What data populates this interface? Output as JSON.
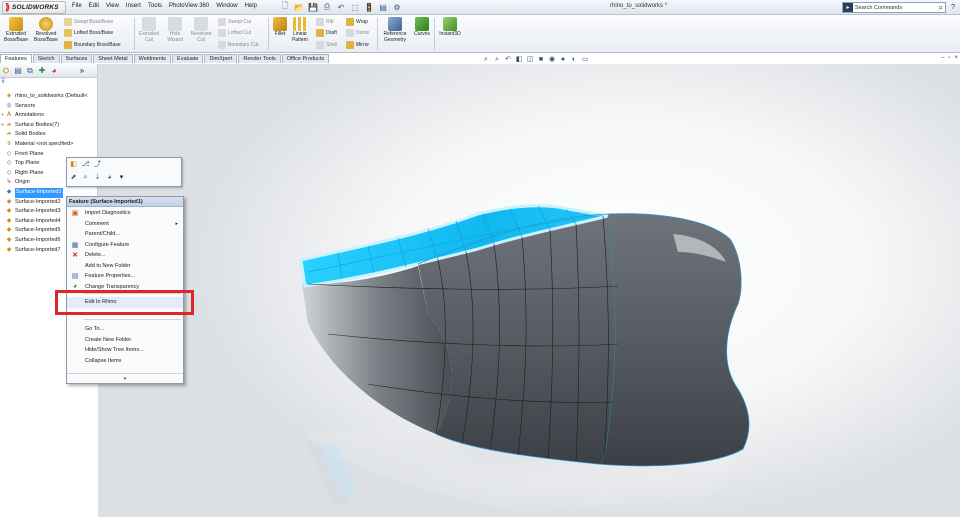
{
  "app": {
    "logo_text": "SOLIDWORKS",
    "document_title": "rhino_to_solidworks *",
    "menu": [
      "File",
      "Edit",
      "View",
      "Insert",
      "Tools",
      "PhotoView 360",
      "Window",
      "Help"
    ],
    "search_placeholder": "Search Commands"
  },
  "ribbon": {
    "extruded": "Extruded Boss/Base",
    "revolved": "Revolved Boss/Base",
    "swept_boss": "Swept Boss/Base",
    "lofted_boss": "Lofted Boss/Base",
    "boundary_boss": "Boundary Boss/Base",
    "extruded_cut": "Extruded Cut",
    "hole_wizard": "Hole Wizard",
    "revolved_cut": "Revolved Cut",
    "swept_cut": "Swept Cut",
    "lofted_cut": "Lofted Cut",
    "boundary_cut": "Boundary Cut",
    "fillet": "Fillet",
    "linear_pattern": "Linear Pattern",
    "rib": "Rib",
    "draft": "Draft",
    "shell": "Shell",
    "wrap": "Wrap",
    "dome": "Dome",
    "mirror": "Mirror",
    "reference_geometry": "Reference Geometry",
    "curves": "Curves",
    "instant3d": "Instant3D"
  },
  "command_tabs": [
    "Features",
    "Sketch",
    "Surfaces",
    "Sheet Metal",
    "Weldments",
    "Evaluate",
    "DimXpert",
    "Render Tools",
    "Office Products"
  ],
  "feature_tree": {
    "filter_icon": "filter-icon",
    "items": [
      {
        "label": "rhino_to_solidworks  (Default<",
        "icon": "part"
      },
      {
        "label": "Sensors",
        "icon": "sensor"
      },
      {
        "label": "Annotations",
        "icon": "annotation"
      },
      {
        "label": "Surface Bodies(7)",
        "icon": "folder"
      },
      {
        "label": "Solid Bodies",
        "icon": "folder"
      },
      {
        "label": "Material <not specified>",
        "icon": "material"
      },
      {
        "label": "Front Plane",
        "icon": "plane"
      },
      {
        "label": "Top Plane",
        "icon": "plane"
      },
      {
        "label": "Right Plane",
        "icon": "plane"
      },
      {
        "label": "Origin",
        "icon": "origin"
      },
      {
        "label": "Surface-Imported1",
        "icon": "surface"
      },
      {
        "label": "Surface-Imported2",
        "icon": "surface"
      },
      {
        "label": "Surface-Imported3",
        "icon": "surface"
      },
      {
        "label": "Surface-Imported4",
        "icon": "surface"
      },
      {
        "label": "Surface-Imported5",
        "icon": "surface"
      },
      {
        "label": "Surface-Imported6",
        "icon": "surface"
      },
      {
        "label": "Surface-Imported7",
        "icon": "surface"
      }
    ]
  },
  "context_menu": {
    "header": "Feature (Surface-Imported1)",
    "items": {
      "import_diagnostics": "Import Diagnostics",
      "comment": "Comment",
      "parent_child": "Parent/Child...",
      "configure_feature": "Configure Feature",
      "delete": "Delete...",
      "add_to_new_folder": "Add to New Folder",
      "feature_properties": "Feature Properties...",
      "change_transparency": "Change Transparency",
      "edit_in_rhino": "Edit In Rhino",
      "go_to": "Go To...",
      "create_new_folder": "Create New Folder",
      "hide_show_tree_items": "Hide/Show Tree Items...",
      "collapse_items": "Collapse Items"
    },
    "more": "»"
  },
  "colors": {
    "highlight_box": "#e0242a",
    "selected_surface": "#19c2f5",
    "selection": "#3399ff"
  }
}
